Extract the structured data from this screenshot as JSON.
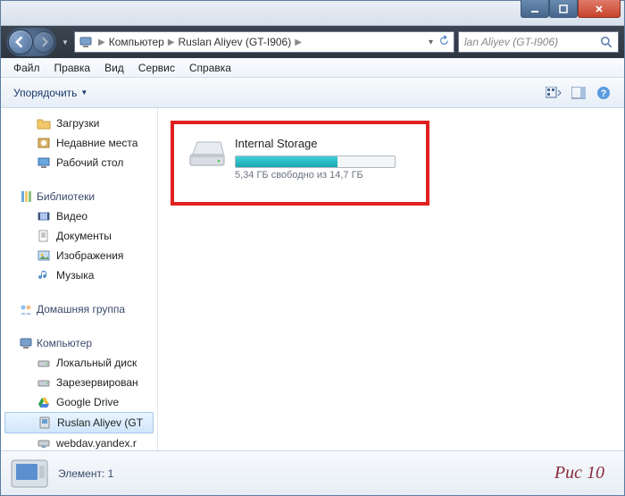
{
  "window": {
    "min_tip": "Minimize",
    "max_tip": "Maximize",
    "close_tip": "Close"
  },
  "breadcrumb": {
    "root_icon": "monitor",
    "segments": [
      "Компьютер",
      "Ruslan Aliyev (GT-I906)"
    ],
    "refresh_tip": "Refresh"
  },
  "search": {
    "placeholder": "lan Aliyev (GT-I906)"
  },
  "menu": {
    "file": "Файл",
    "edit": "Правка",
    "view": "Вид",
    "service": "Сервис",
    "help": "Справка"
  },
  "toolbar": {
    "organize": "Упорядочить",
    "view_mode_tip": "View options",
    "preview_tip": "Preview pane",
    "help_tip": "Help"
  },
  "sidebar": {
    "favorites": {
      "items": [
        {
          "icon": "download",
          "label": "Загрузки"
        },
        {
          "icon": "recent",
          "label": "Недавние места"
        },
        {
          "icon": "desktop",
          "label": "Рабочий стол"
        }
      ]
    },
    "libraries": {
      "label": "Библиотеки",
      "items": [
        {
          "icon": "video",
          "label": "Видео"
        },
        {
          "icon": "document",
          "label": "Документы"
        },
        {
          "icon": "picture",
          "label": "Изображения"
        },
        {
          "icon": "music",
          "label": "Музыка"
        }
      ]
    },
    "homegroup": {
      "label": "Домашняя группа"
    },
    "computer": {
      "label": "Компьютер",
      "items": [
        {
          "icon": "disk",
          "label": "Локальный диск"
        },
        {
          "icon": "disk",
          "label": "Зарезервирован"
        },
        {
          "icon": "gdrive",
          "label": "Google Drive"
        },
        {
          "icon": "device",
          "label": "Ruslan Aliyev (GT",
          "active": true
        },
        {
          "icon": "netdisk",
          "label": "webdav.yandex.r"
        }
      ]
    }
  },
  "main": {
    "drive": {
      "name": "Internal Storage",
      "free_text": "5,34 ГБ свободно из 14,7 ГБ",
      "used_percent": 64
    }
  },
  "status": {
    "text": "Элемент: 1"
  },
  "figure_label": "Рис 10"
}
